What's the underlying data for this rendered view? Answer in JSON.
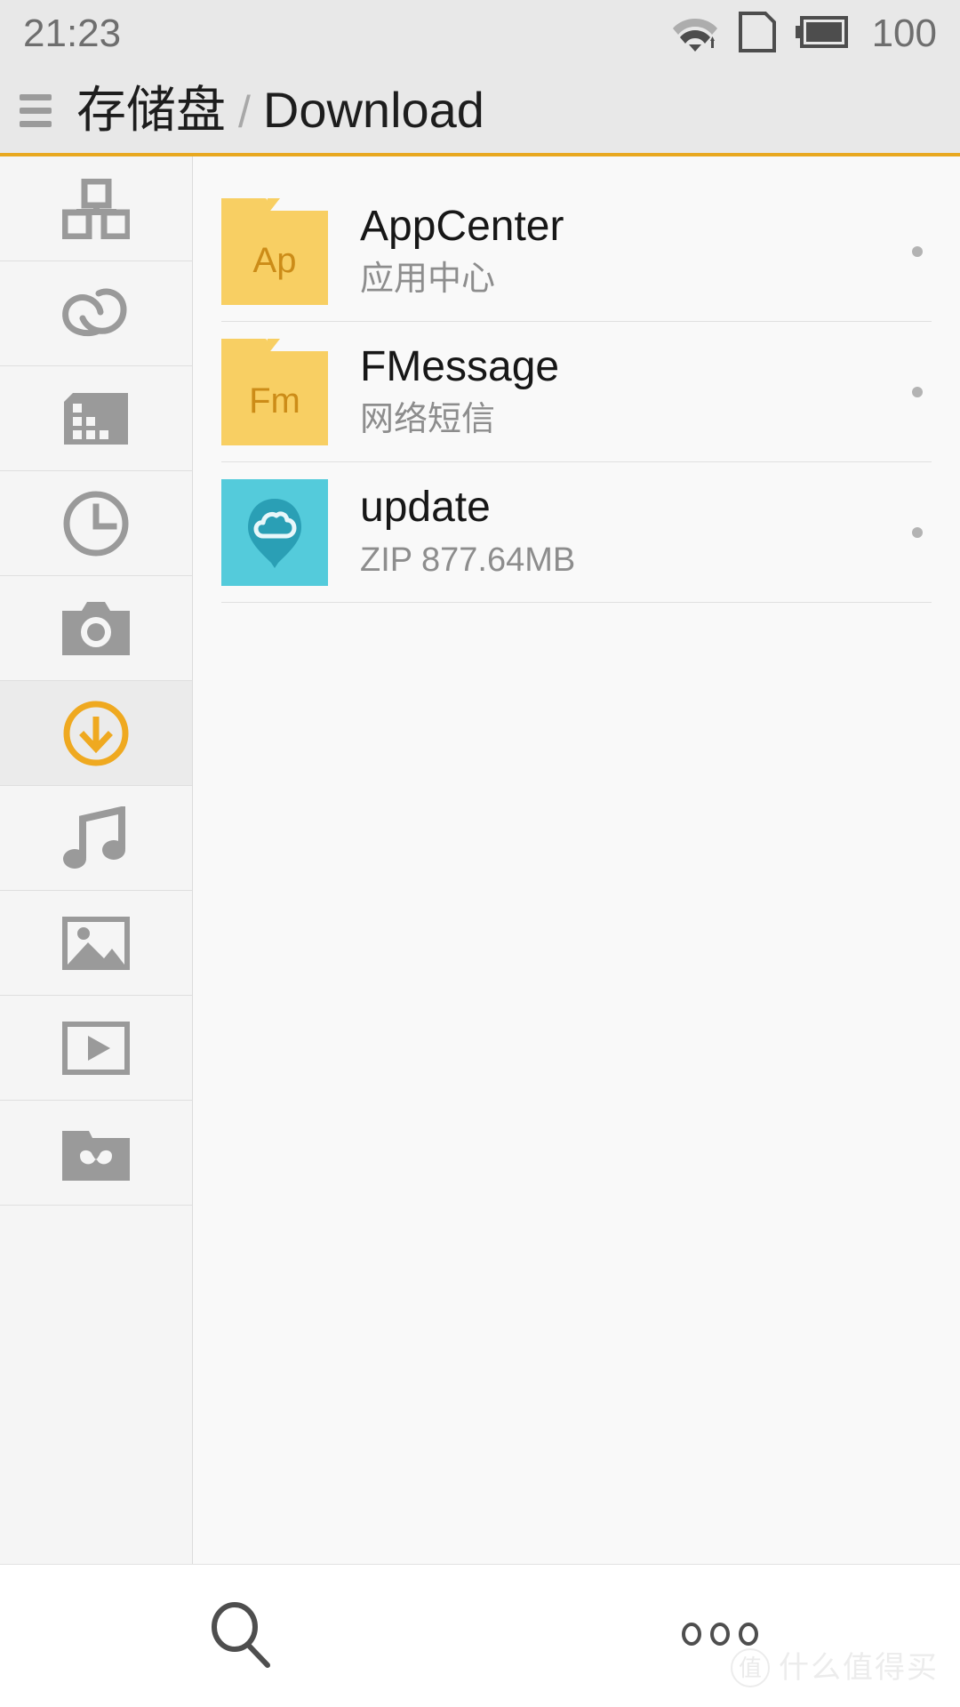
{
  "status_bar": {
    "time": "21:23",
    "battery_level": "100",
    "icons": [
      "wifi-icon",
      "sim-card-icon",
      "battery-icon"
    ]
  },
  "title_bar": {
    "menu_icon": "hamburger-menu-icon",
    "breadcrumb_root": "存储盘",
    "breadcrumb_separator": "/",
    "breadcrumb_current": "Download",
    "accent_color": "#e8a820"
  },
  "sidebar": {
    "items": [
      {
        "name": "categories",
        "icon": "blocks-categories-icon",
        "active": false
      },
      {
        "name": "cloud",
        "icon": "cloud-icon",
        "active": false
      },
      {
        "name": "sd-card",
        "icon": "sd-card-icon",
        "active": false
      },
      {
        "name": "recent",
        "icon": "clock-icon",
        "active": false
      },
      {
        "name": "camera",
        "icon": "camera-icon",
        "active": false
      },
      {
        "name": "downloads",
        "icon": "download-circle-icon",
        "active": true
      },
      {
        "name": "music",
        "icon": "music-note-icon",
        "active": false
      },
      {
        "name": "images",
        "icon": "image-picture-icon",
        "active": false
      },
      {
        "name": "videos",
        "icon": "video-play-icon",
        "active": false
      },
      {
        "name": "archives",
        "icon": "archive-folder-icon",
        "active": false
      }
    ],
    "active_color": "#efa920",
    "icon_color": "#9a9a9a"
  },
  "file_list": {
    "items": [
      {
        "icon_type": "folder",
        "icon_label": "Ap",
        "name": "AppCenter",
        "meta": "应用中心",
        "has_dot": true
      },
      {
        "icon_type": "folder",
        "icon_label": "Fm",
        "name": "FMessage",
        "meta": "网络短信",
        "has_dot": true
      },
      {
        "icon_type": "zip",
        "icon_label": "cloud-balloon-icon",
        "name": "update",
        "meta": "ZIP 877.64MB",
        "has_dot": true
      }
    ],
    "folder_color": "#f8cf63",
    "folder_text_color": "#cc8c18",
    "zip_color": "#54cbdb"
  },
  "bottom_bar": {
    "search_icon": "search-icon",
    "more_icon": "more-options-icon"
  },
  "watermark": {
    "logo": "值",
    "text": "什么值得买"
  }
}
